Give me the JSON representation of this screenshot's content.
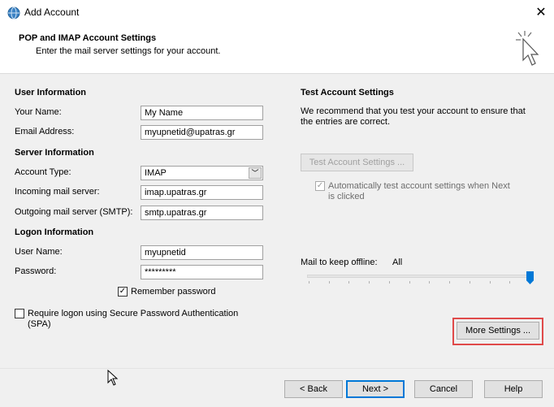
{
  "window": {
    "title": "Add Account",
    "close_icon": "close-icon"
  },
  "header": {
    "title": "POP and IMAP Account Settings",
    "subtitle": "Enter the mail server settings for your account."
  },
  "user_info": {
    "heading": "User Information",
    "name_label": "Your Name:",
    "name_value": "My Name",
    "email_label": "Email Address:",
    "email_value": "myupnetid@upatras.gr"
  },
  "server_info": {
    "heading": "Server Information",
    "account_type_label": "Account Type:",
    "account_type_value": "IMAP",
    "incoming_label": "Incoming mail server:",
    "incoming_value": "imap.upatras.gr",
    "outgoing_label": "Outgoing mail server (SMTP):",
    "outgoing_value": "smtp.upatras.gr"
  },
  "logon_info": {
    "heading": "Logon Information",
    "username_label": "User Name:",
    "username_value": "myupnetid",
    "password_label": "Password:",
    "password_value": "*********",
    "remember_label": "Remember password",
    "remember_checked": true,
    "spa_label_line1": "Require logon using Secure Password Authentication",
    "spa_label_line2": "(SPA)",
    "spa_checked": false
  },
  "test_settings": {
    "heading": "Test Account Settings",
    "desc_line1": "We recommend that you test your account to ensure that",
    "desc_line2": "the entries are correct.",
    "button_label": "Test Account Settings ...",
    "auto_test_line1": "Automatically test account settings when Next",
    "auto_test_line2": "is clicked",
    "auto_test_checked": true
  },
  "offline": {
    "label": "Mail to keep offline:",
    "value": "All",
    "slider_fraction": 1.0
  },
  "more_settings_label": "More Settings ...",
  "footer": {
    "back_label": "< Back",
    "next_label": "Next >",
    "cancel_label": "Cancel",
    "help_label": "Help"
  },
  "colors": {
    "accent": "#0078d7",
    "highlight": "#e04a4a",
    "panel": "#f0f0f0"
  }
}
